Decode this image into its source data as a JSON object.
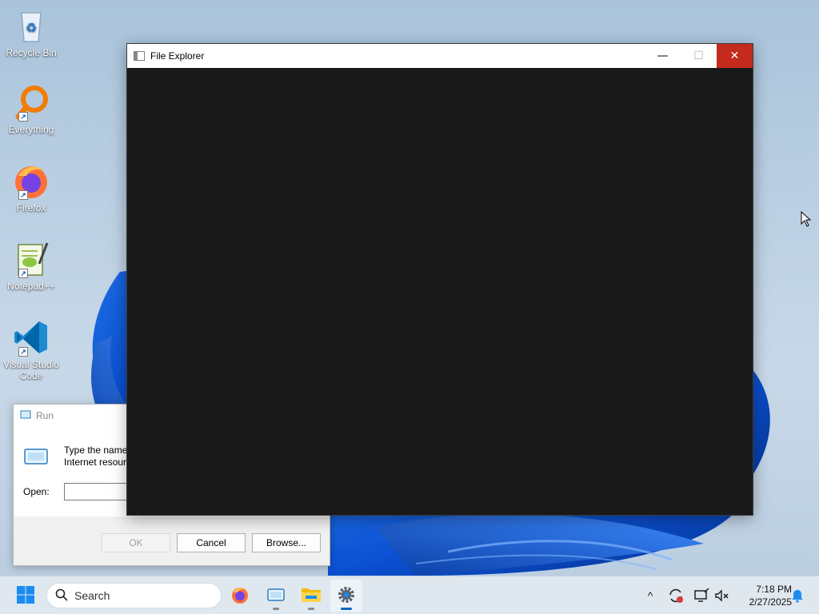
{
  "desktop": {
    "icons": [
      {
        "label": "Recycle Bin",
        "icon": "recycle-bin-icon"
      },
      {
        "label": "Everything",
        "icon": "everything-search-icon"
      },
      {
        "label": "Firefox",
        "icon": "firefox-icon"
      },
      {
        "label": "Notepad++",
        "icon": "notepad-plus-plus-icon"
      },
      {
        "label": "Visual Studio Code",
        "icon": "vscode-icon"
      }
    ]
  },
  "explorer": {
    "title": "File Explorer",
    "minimize": "—",
    "maximize": "☐",
    "close": "✕"
  },
  "run": {
    "title": "Run",
    "description": "Type the name of a program, folder, document, or Internet resource, and Windows will open it for you.",
    "open_label": "Open:",
    "open_value": "",
    "ok_label": "OK",
    "cancel_label": "Cancel",
    "browse_label": "Browse..."
  },
  "taskbar": {
    "search_label": "Search",
    "pinned": [
      "start-icon",
      "firefox-icon",
      "run-icon",
      "file-explorer-icon",
      "settings-icon"
    ],
    "tray_chevron": "^",
    "time": "7:18 PM",
    "date": "2/27/2025"
  },
  "colors": {
    "close_button": "#c42b1c",
    "accent": "#0067c0",
    "explorer_body": "#191919"
  }
}
